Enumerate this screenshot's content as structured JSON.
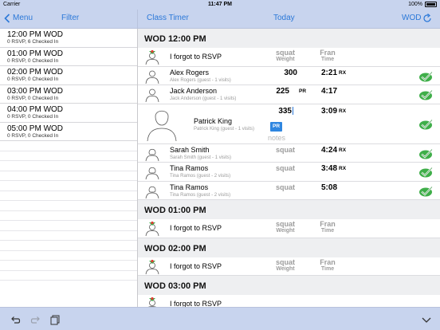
{
  "status_bar": {
    "carrier": "Carrier",
    "time": "11:47 PM",
    "battery": "100%"
  },
  "left_nav": {
    "back_label": "Menu",
    "filter_label": "Filter"
  },
  "right_nav": {
    "class_timer_label": "Class Timer",
    "today_label": "Today",
    "wod_label": "WOD"
  },
  "classes": [
    {
      "time": "12:00 PM WOD",
      "sub": "0 RSVP, 6 Checked In"
    },
    {
      "time": "01:00 PM WOD",
      "sub": "0 RSVP, 0 Checked In"
    },
    {
      "time": "02:00 PM WOD",
      "sub": "0 RSVP, 0 Checked In"
    },
    {
      "time": "03:00 PM WOD",
      "sub": "0 RSVP, 0 Checked In"
    },
    {
      "time": "04:00 PM WOD",
      "sub": "0 RSVP, 0 Checked In"
    },
    {
      "time": "05:00 PM WOD",
      "sub": "0 RSVP, 0 Checked In"
    }
  ],
  "sections": [
    {
      "title": "WOD 12:00 PM",
      "rsvp_label": "I forgot to RSVP",
      "col1_title": "squat",
      "col1_sub": "Weight",
      "col2_title": "Fran",
      "col2_sub": "Time",
      "athletes": [
        {
          "name": "Alex Rogers",
          "sub": "Alex Rogers (guest - 1 visits)",
          "score1": "300",
          "tag1": "",
          "score2": "2:21",
          "tag2": "RX",
          "score1_placeholder": ""
        },
        {
          "name": "Jack Anderson",
          "sub": "Jack Anderson (guest - 1 visits)",
          "score1": "225",
          "tag1": "PR",
          "score2": "4:17",
          "tag2": "",
          "score1_placeholder": ""
        },
        {
          "name": "Patrick King",
          "sub": "Patrick King (guest - 1 visits)",
          "score1": "335",
          "tag1": "",
          "score2": "3:09",
          "tag2": "RX",
          "score1_placeholder": "",
          "pr_badge": "PR",
          "notes_placeholder": "notes"
        },
        {
          "name": "Sarah Smith",
          "sub": "Sarah Smith (guest - 1 visits)",
          "score1": "",
          "tag1": "",
          "score2": "4:24",
          "tag2": "RX",
          "score1_placeholder": "squat"
        },
        {
          "name": "Tina Ramos",
          "sub": "Tina Ramos (guest - 2 visits)",
          "score1": "",
          "tag1": "",
          "score2": "3:48",
          "tag2": "RX",
          "score1_placeholder": "squat"
        },
        {
          "name": "Tina Ramos",
          "sub": "Tina Ramos (guest - 2 visits)",
          "score1": "",
          "tag1": "",
          "score2": "5:08",
          "tag2": "",
          "score1_placeholder": "squat"
        }
      ]
    },
    {
      "title": "WOD 01:00 PM",
      "rsvp_label": "I forgot to RSVP",
      "col1_title": "squat",
      "col1_sub": "Weight",
      "col2_title": "Fran",
      "col2_sub": "Time"
    },
    {
      "title": "WOD 02:00 PM",
      "rsvp_label": "I forgot to RSVP",
      "col1_title": "squat",
      "col1_sub": "Weight",
      "col2_title": "Fran",
      "col2_sub": "Time"
    },
    {
      "title": "WOD 03:00 PM",
      "rsvp_label": "I forgot to RSVP"
    }
  ],
  "colors": {
    "accent": "#2b78d8",
    "check_green": "#3fae49",
    "nav_bg": "#c8d4ee",
    "pr_badge": "#2f86e0"
  },
  "icons": [
    "chevron-left-icon",
    "refresh-icon",
    "add-person-icon",
    "person-outline-icon",
    "check-circle-icon",
    "undo-icon",
    "redo-icon",
    "copy-icon",
    "chevron-down-icon"
  ]
}
